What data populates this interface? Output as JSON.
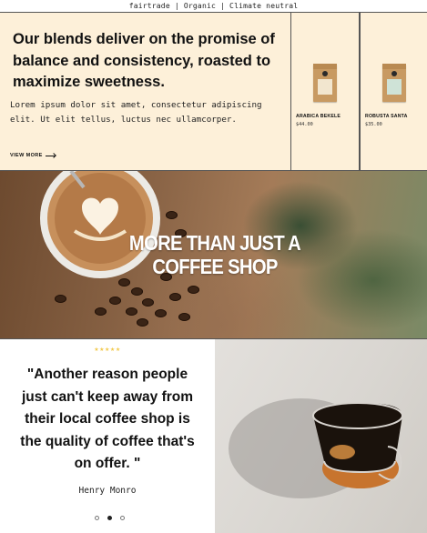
{
  "topbar": {
    "text": "fairtrade | Organic | Climate neutral"
  },
  "hero": {
    "title": "Our blends deliver on the promise of balance and consistency, roasted to maximize sweetness.",
    "body": "Lorem ipsum dolor sit amet, consectetur adipiscing elit. Ut elit tellus, luctus nec ullamcorper.",
    "cta": "VIEW MORE"
  },
  "products": [
    {
      "name": "ARABICA BEKELE",
      "price": "$44.00",
      "icon": "coffee-bag-icon"
    },
    {
      "name": "ROBUSTA SANTA",
      "price": "$35.00",
      "icon": "coffee-bag-icon"
    }
  ],
  "banner": {
    "title": "MORE THAN JUST A COFFEE SHOP"
  },
  "testimonial": {
    "stars": "★★★★★",
    "quote": "\"Another reason people just can't keep away from their local coffee shop is the quality of coffee that's on offer. \"",
    "author": "Henry Monro"
  },
  "colors": {
    "hero_bg": "#fdf0d9",
    "star": "#f2c94c",
    "border": "#555555"
  }
}
